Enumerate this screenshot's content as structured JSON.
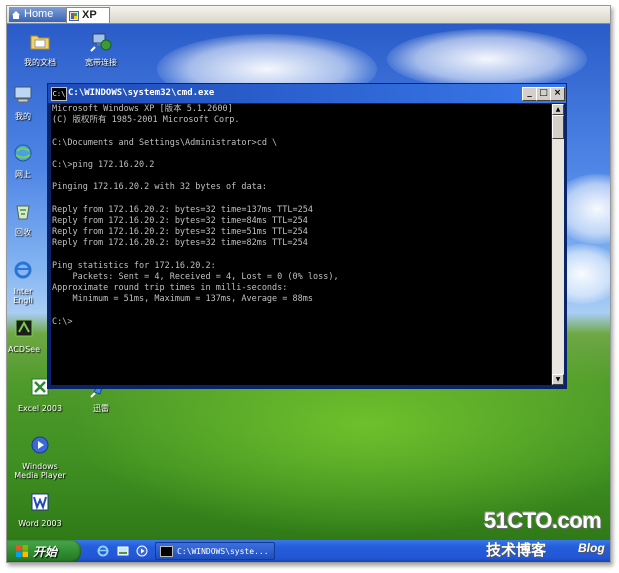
{
  "vm_tabs": [
    {
      "label": "Home",
      "active": false
    },
    {
      "label": "XP",
      "active": true
    }
  ],
  "desktop_icons": {
    "my_docs": "我的文档",
    "network": "宽带连接",
    "computer": "我的",
    "ie": "网上",
    "recycle": "回收",
    "inter": "Inter",
    "engli": "Engli",
    "acdsee": "ACDSee",
    "excel": "Excel 2003",
    "xunlei": "迅雷",
    "wmp_line1": "Windows",
    "wmp_line2": "Media Player",
    "word": "Word 2003"
  },
  "cmd": {
    "title": "C:\\WINDOWS\\system32\\cmd.exe",
    "icon_text": "C:\\",
    "btn_min": "_",
    "btn_max": "□",
    "btn_close": "×",
    "lines": [
      "Microsoft Windows XP [版本 5.1.2600]",
      "(C) 版权所有 1985-2001 Microsoft Corp.",
      "",
      "C:\\Documents and Settings\\Administrator>cd \\",
      "",
      "C:\\>ping 172.16.20.2",
      "",
      "Pinging 172.16.20.2 with 32 bytes of data:",
      "",
      "Reply from 172.16.20.2: bytes=32 time=137ms TTL=254",
      "Reply from 172.16.20.2: bytes=32 time=84ms TTL=254",
      "Reply from 172.16.20.2: bytes=32 time=51ms TTL=254",
      "Reply from 172.16.20.2: bytes=32 time=82ms TTL=254",
      "",
      "Ping statistics for 172.16.20.2:",
      "    Packets: Sent = 4, Received = 4, Lost = 0 (0% loss),",
      "Approximate round trip times in milli-seconds:",
      "    Minimum = 51ms, Maximum = 137ms, Average = 88ms",
      "",
      "C:\\>"
    ],
    "scroll_up": "▲",
    "scroll_down": "▼"
  },
  "taskbar": {
    "start_label": "开始",
    "task_cmd_label": "C:\\WINDOWS\\syste..."
  },
  "watermark": {
    "big": "51CTO.com",
    "small": "技术博客",
    "blog": "Blog"
  },
  "colors": {
    "console_bg": "#000000",
    "console_text": "#c0c0c0",
    "title_blue": "#1e4bb6",
    "start_green": "#2f8b2f"
  }
}
